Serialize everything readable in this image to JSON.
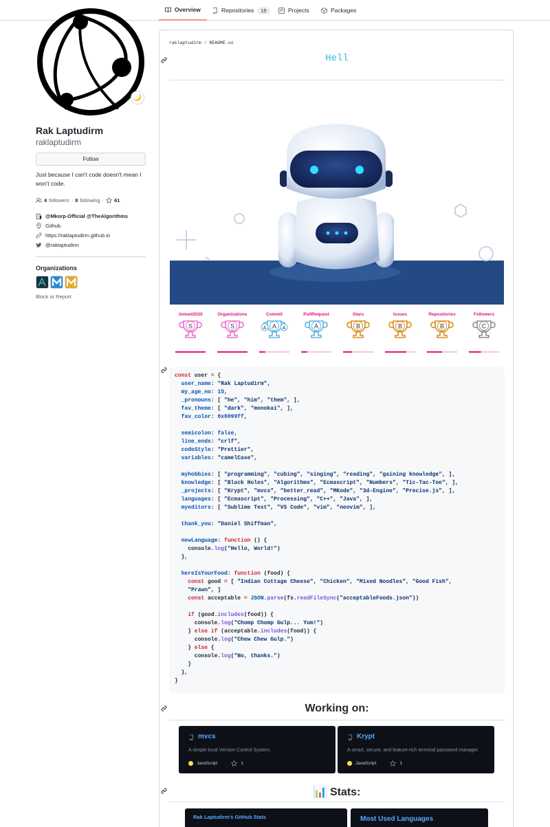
{
  "tabs": [
    {
      "label": "Overview",
      "icon": "book-icon",
      "active": true
    },
    {
      "label": "Repositories",
      "icon": "repo-icon",
      "count": "15"
    },
    {
      "label": "Projects",
      "icon": "project-icon"
    },
    {
      "label": "Packages",
      "icon": "package-icon"
    }
  ],
  "profile": {
    "name": "Rak Laptudirm",
    "login": "raklaptudirm",
    "follow_label": "Follow",
    "bio": "Just because I can't code doesn't mean I won't code.",
    "followers": "4",
    "followers_label": "followers",
    "following": "8",
    "following_label": "following",
    "stars": "61",
    "status_emoji": "🌙",
    "company": "@Mkorp-Official @TheAlgorithms",
    "location": "Github",
    "website": "https://raklaptudirm.github.io",
    "twitter": "@raklaptudirm"
  },
  "organizations": {
    "heading": "Organizations",
    "block_label": "Block or Report"
  },
  "readme": {
    "path_user": "raklaptudirm",
    "path_sep": " / ",
    "path_file": "README",
    "path_ext": ".md",
    "typing_text": "Hell"
  },
  "trophies": [
    {
      "label": "Joined2020",
      "rank": "S",
      "color": "#e86fcf",
      "fill": 1.0
    },
    {
      "label": "Organizations",
      "rank": "S",
      "color": "#e86fcf",
      "fill": 1.0
    },
    {
      "label": "Commit",
      "rank": "AAA",
      "color": "#5cb3e6",
      "fill": 0.2
    },
    {
      "label": "PullRequest",
      "rank": "A",
      "color": "#5cb3e6",
      "fill": 0.2
    },
    {
      "label": "Stars",
      "rank": "B",
      "color": "#d98b1e",
      "fill": 0.3
    },
    {
      "label": "Issues",
      "rank": "B",
      "color": "#d98b1e",
      "fill": 0.7
    },
    {
      "label": "Repositories",
      "rank": "B",
      "color": "#d98b1e",
      "fill": 0.5
    },
    {
      "label": "Followers",
      "rank": "C",
      "color": "#8c8c8c",
      "fill": 0.4
    }
  ],
  "working_on": {
    "heading": "Working on:",
    "projects": [
      {
        "name": "mvcs",
        "desc": "A simple local Version Control System.",
        "lang": "JavaScript",
        "stars": "1"
      },
      {
        "name": "Krypt",
        "desc": "A smart, secure, and feature-rich terminal password manager.",
        "lang": "JavaScript",
        "stars": "1"
      }
    ]
  },
  "stats": {
    "heading": "📊 Stats:",
    "card1_title": "Rak Laptudirm's GitHub Stats",
    "card2_title": "Most Used Languages"
  },
  "colors": {
    "accent": "#fd8c73",
    "link": "#58a6ff",
    "card_bg": "#0d1117",
    "js_dot": "#f1e05a"
  }
}
